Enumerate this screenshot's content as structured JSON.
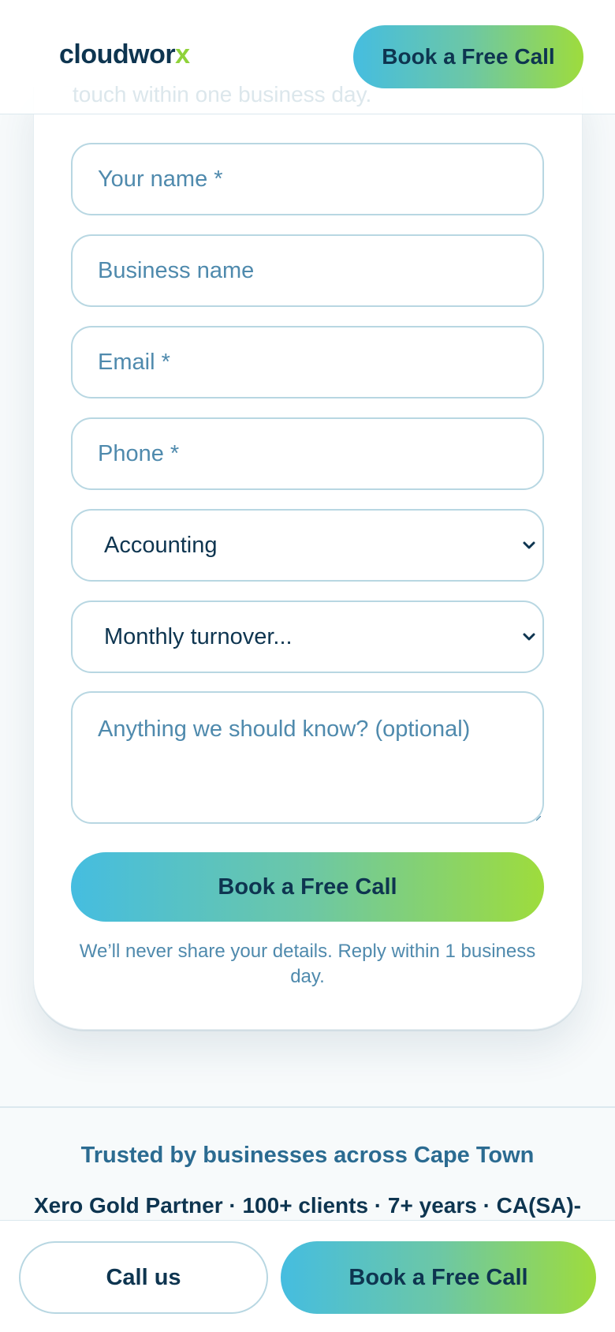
{
  "header": {
    "logo_main": "cloudwor",
    "logo_accent": "x",
    "cta_label": "Book a Free Call",
    "behind_text": "touch within one business day."
  },
  "form": {
    "name_placeholder": "Your name *",
    "business_placeholder": "Business name",
    "email_placeholder": "Email *",
    "phone_placeholder": "Phone *",
    "service_selected": "Accounting",
    "turnover_selected": "Monthly turnover...",
    "notes_placeholder": "Anything we should know? (optional)",
    "submit_label": "Book a Free Call",
    "privacy_note": "We’ll never share your details. Reply within 1 business day."
  },
  "trust": {
    "title": "Trusted by businesses across Cape Town",
    "credentials": "Xero Gold Partner · 100+ clients · 7+ years · CA(SA)-"
  },
  "bottom_bar": {
    "call_label": "Call us",
    "cta_label": "Book a Free Call"
  },
  "colors": {
    "navy": "#0e3550",
    "accent_blue": "#45bde0",
    "accent_green": "#9edc3c",
    "muted_blue": "#4f8aad",
    "field_border": "#b8d7e2"
  }
}
